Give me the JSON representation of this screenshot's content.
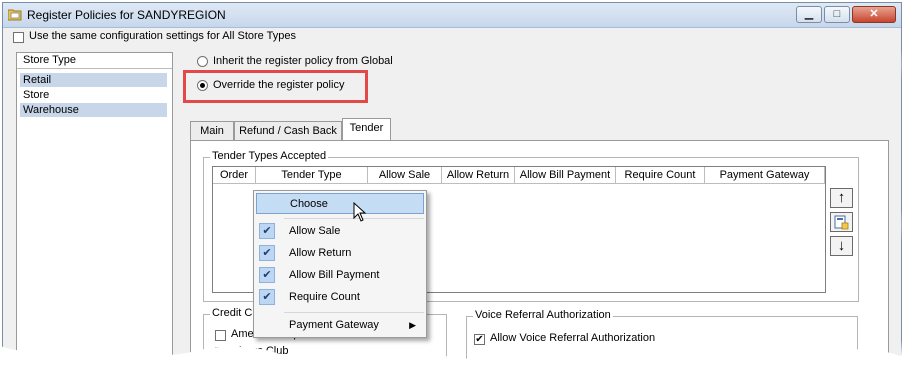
{
  "window": {
    "title": "Register Policies for SANDYREGION",
    "controls": {
      "minimize": "▭",
      "maximize": "□",
      "close": "✕"
    }
  },
  "same_config": {
    "label": "Use the same configuration settings for All Store Types",
    "checked": false
  },
  "store_types": {
    "header": "Store Type",
    "items": [
      {
        "label": "Retail",
        "selected": true
      },
      {
        "label": "Store",
        "selected": false
      },
      {
        "label": "Warehouse",
        "selected": true
      }
    ]
  },
  "policy": {
    "inherit_label": "Inherit the register policy from Global",
    "override_label": "Override the register policy",
    "selected": "override"
  },
  "tabs": [
    {
      "label": "Main",
      "active": false
    },
    {
      "label": "Refund / Cash Back",
      "active": false
    },
    {
      "label": "Tender",
      "active": true
    }
  ],
  "tender_types": {
    "group_title": "Tender Types Accepted",
    "columns": [
      "Order",
      "Tender Type",
      "Allow Sale",
      "Allow Return",
      "Allow Bill Payment",
      "Require Count",
      "Payment Gateway"
    ],
    "side_buttons": {
      "up": "↑",
      "edit": "edit-icon",
      "down": "↓"
    }
  },
  "context_menu": {
    "choose": "Choose",
    "items": [
      {
        "label": "Allow Sale",
        "checked": true
      },
      {
        "label": "Allow Return",
        "checked": true
      },
      {
        "label": "Allow Bill Payment",
        "checked": true
      },
      {
        "label": "Require Count",
        "checked": true
      }
    ],
    "submenu": {
      "label": "Payment Gateway"
    }
  },
  "credit_cards": {
    "group_title_partial": "Credit C",
    "items": [
      "American Express",
      "Diners Club"
    ]
  },
  "voice_referral": {
    "group_title": "Voice Referral Authorization",
    "checkbox_label": "Allow Voice Referral Authorization",
    "checked": true
  },
  "colors": {
    "highlight_box": "#e24a4a",
    "selection": "#c8d6ea",
    "menu_hover": "#c4dcf4"
  }
}
